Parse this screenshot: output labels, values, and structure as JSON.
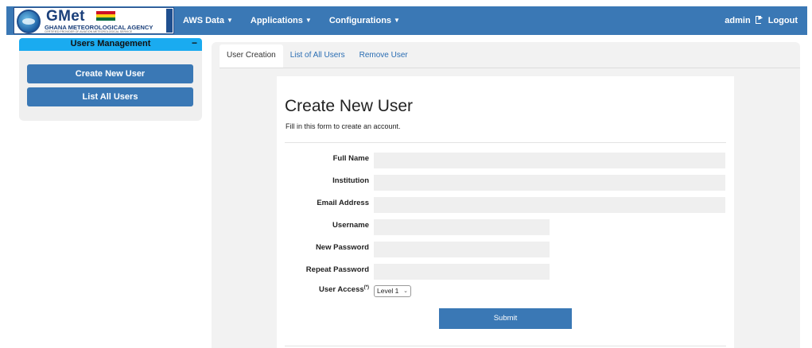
{
  "brand": {
    "name": "GMet",
    "agency": "GHANA METEOROLOGICAL AGENCY",
    "tagline": "CERTIFIED PROVIDER OF AVIATION METEOROLOGICAL SERVICE",
    "flag_colors": [
      "#ce1126",
      "#fcd116",
      "#006b3f"
    ]
  },
  "nav": {
    "items": [
      {
        "label": "AWS Data"
      },
      {
        "label": "Applications"
      },
      {
        "label": "Configurations"
      }
    ],
    "user": "admin",
    "logout_label": "Logout"
  },
  "sidebar": {
    "title": "Users Management",
    "collapse_symbol": "−",
    "buttons": [
      {
        "label": "Create New User"
      },
      {
        "label": "List All Users"
      }
    ]
  },
  "tabs": [
    {
      "label": "User Creation",
      "active": true
    },
    {
      "label": "List of All Users",
      "active": false
    },
    {
      "label": "Remove User",
      "active": false
    }
  ],
  "form": {
    "title": "Create New User",
    "subtitle": "Fill in this form to create an account.",
    "fields": [
      {
        "label": "Full Name",
        "value": ""
      },
      {
        "label": "Institution",
        "value": ""
      },
      {
        "label": "Email Address",
        "value": ""
      },
      {
        "label": "Username",
        "value": ""
      },
      {
        "label": "New Password",
        "value": ""
      },
      {
        "label": "Repeat Password",
        "value": ""
      }
    ],
    "access_label": "User Access",
    "access_note": "(*)",
    "access_value": "Level 1",
    "submit_label": "Submit"
  },
  "colors": {
    "navbar": "#3a78b5",
    "sidebar_header": "#1aabf0",
    "link": "#2a6db3"
  }
}
